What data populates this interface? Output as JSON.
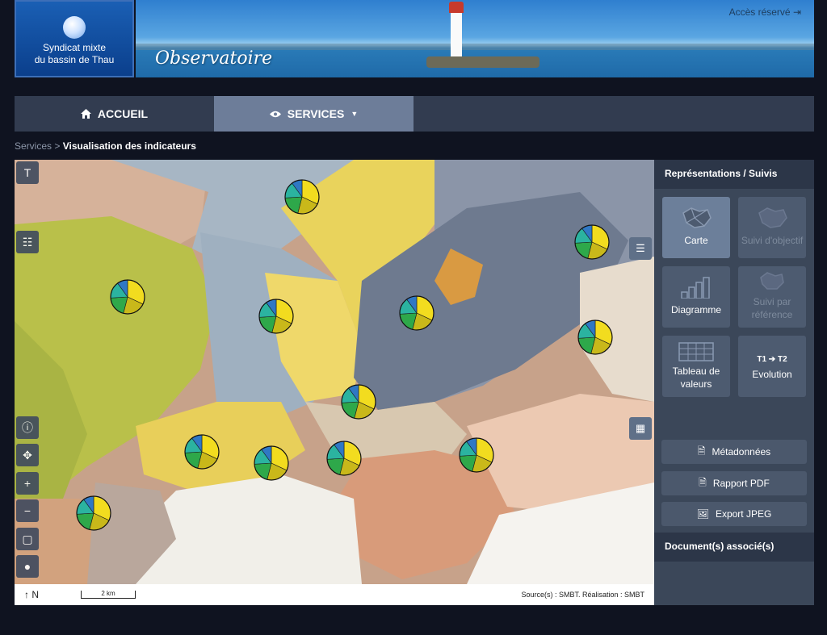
{
  "header": {
    "logo_line1": "Syndicat mixte",
    "logo_line2": "du bassin de Thau",
    "banner_title": "Observatoire",
    "acces": "Accès réservé"
  },
  "nav": {
    "items": [
      {
        "label": "ACCUEIL",
        "icon": "home-icon"
      },
      {
        "label": "SERVICES",
        "icon": "eye-icon"
      }
    ]
  },
  "breadcrumb": {
    "parent": "Services",
    "separator": ">",
    "current": "Visualisation des indicateurs"
  },
  "map": {
    "north": "N",
    "scale": "2 km",
    "source": "Source(s) : SMBT. Réalisation : SMBT",
    "pie_colors": [
      "#f2dc1f",
      "#c9b81a",
      "#2ea84a",
      "#2bb3a0",
      "#2f78c4"
    ]
  },
  "panel": {
    "title": "Représentations / Suivis",
    "tiles": [
      {
        "label": "Carte",
        "state": "active"
      },
      {
        "label": "Suivi d'objectif",
        "state": "disabled"
      },
      {
        "label": "Diagramme",
        "state": "normal"
      },
      {
        "label": "Suivi par référence",
        "state": "disabled"
      },
      {
        "label": "Tableau de valeurs",
        "state": "normal"
      },
      {
        "label": "Evolution",
        "icon_text": "T1 ➔ T2",
        "state": "normal"
      }
    ],
    "actions": [
      {
        "label": "Métadonnées",
        "icon": "document-icon"
      },
      {
        "label": "Rapport PDF",
        "icon": "pdf-icon"
      },
      {
        "label": "Export JPEG",
        "icon": "image-icon"
      }
    ],
    "docs_title": "Document(s) associé(s)"
  }
}
